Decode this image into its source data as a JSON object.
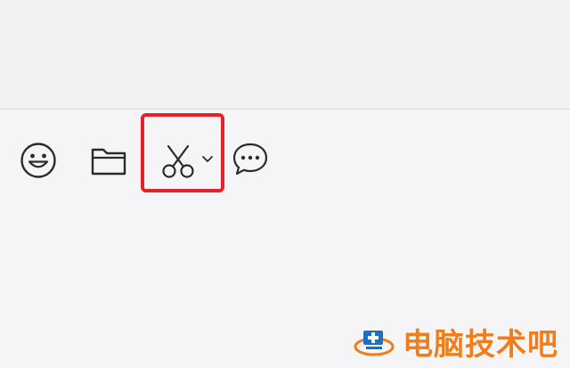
{
  "toolbar": {
    "tools": [
      {
        "id": "emoji",
        "icon": "smiley-face-icon"
      },
      {
        "id": "file",
        "icon": "folder-icon"
      },
      {
        "id": "screenshot",
        "icon": "scissors-icon",
        "has_dropdown": true
      },
      {
        "id": "chat-history",
        "icon": "speech-bubble-icon"
      }
    ],
    "highlighted_tool": "screenshot"
  },
  "colors": {
    "highlight": "#e8202a",
    "watermark": "#f07d1a",
    "icon_stroke": "#2b2b2b"
  },
  "watermark": {
    "text": "电脑技术吧"
  }
}
